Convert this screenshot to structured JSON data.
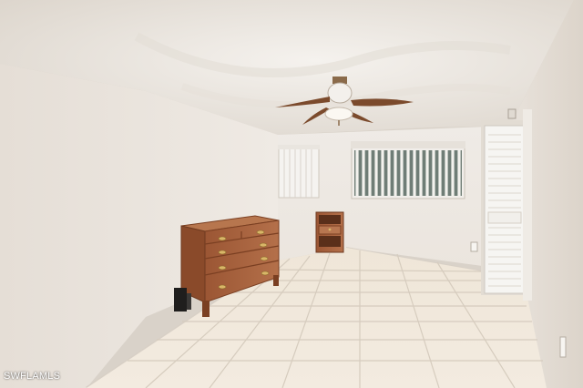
{
  "watermark": "SWFLAMLS",
  "colors": {
    "wall": "#ece7e1",
    "wall_shadow": "#d6cfc6",
    "ceiling": "#f2eeea",
    "floor_tile": "#efe6d9",
    "grout": "#d4c9ba",
    "wood": "#a65f3a",
    "wood_dark": "#7a3f22",
    "blind": "#f4f2ef",
    "door": "#f5f4f1"
  }
}
